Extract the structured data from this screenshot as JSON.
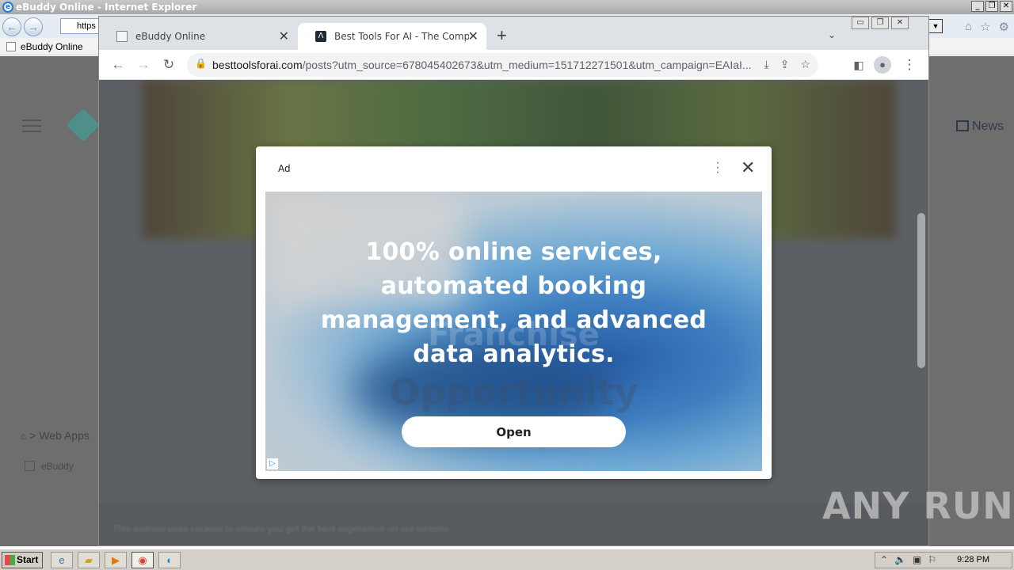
{
  "ie": {
    "title": "eBuddy Online - Internet Explorer",
    "address_partial": "https",
    "fav_tab_label": "eBuddy Online",
    "page": {
      "news_label": "News",
      "breadcrumb": "> Web Apps",
      "ebuddy_link": "eBuddy"
    }
  },
  "chrome": {
    "tabs": [
      {
        "label": "eBuddy Online",
        "active": false
      },
      {
        "label": "Best Tools For AI - The Complete Res",
        "active": true
      }
    ],
    "url_domain": "besttoolsforai.com",
    "url_path": "/posts?utm_source=678045402673&utm_medium=151712271501&utm_campaign=EAIaI...",
    "page": {
      "bottom_text": "This website uses cookies to ensure you get the best experience on our website"
    }
  },
  "ad": {
    "label": "Ad",
    "headline": "100% online services, automated booking management, and advanced data analytics.",
    "background_word_1": "Franchise",
    "background_word_2": "Opportunity",
    "open_button": "Open"
  },
  "watermark": "ANY RUN",
  "taskbar": {
    "start_label": "Start",
    "clock": "9:28 PM"
  }
}
